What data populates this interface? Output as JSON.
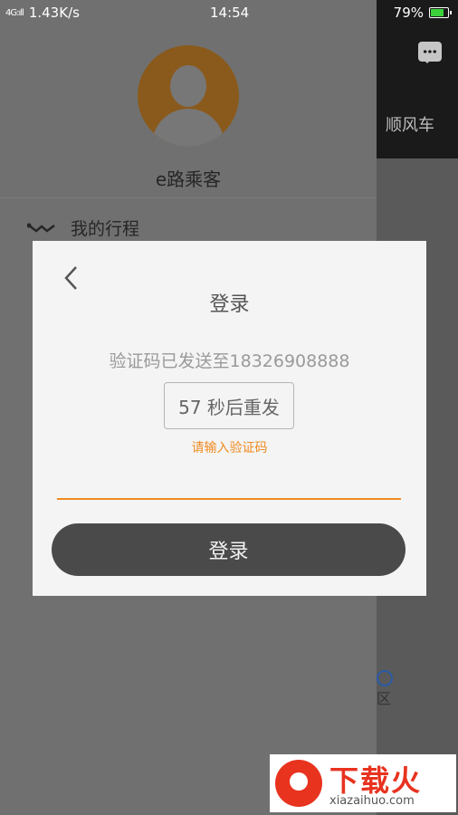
{
  "status_bar": {
    "signal": "4G:ıll",
    "speed": "1.43K/s",
    "time": "14:54",
    "battery_percent": "79%",
    "battery_level": 0.79
  },
  "background": {
    "tab_label": "顺风车",
    "map_label": "区"
  },
  "drawer": {
    "user_name": "e路乘客",
    "menu_items": [
      {
        "label": "我的行程",
        "icon": "route-icon"
      }
    ]
  },
  "dialog": {
    "title": "登录",
    "sent_prefix": "验证码已发送至",
    "phone": "18326908888",
    "resend_label": "57 秒后重发",
    "hint": "请输入验证码",
    "code_value": "",
    "login_label": "登录"
  },
  "watermark": {
    "title": "下载火",
    "url": "xiazaihuo.com"
  },
  "colors": {
    "accent": "#f08b22",
    "button_dark": "#4a4a4a",
    "dialog_bg": "#f4f4f4"
  }
}
